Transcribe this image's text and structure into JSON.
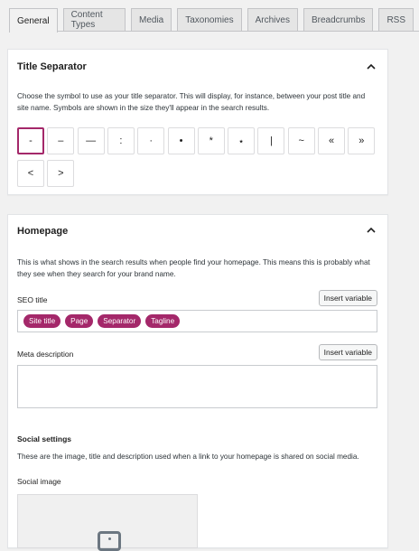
{
  "tabs": [
    "General",
    "Content Types",
    "Media",
    "Taxonomies",
    "Archives",
    "Breadcrumbs",
    "RSS"
  ],
  "active_tab": "General",
  "title_separator": {
    "heading": "Title Separator",
    "description": "Choose the symbol to use as your title separator. This will display, for instance, between your post title and site name. Symbols are shown in the size they'll appear in the search results.",
    "symbols": [
      "-",
      "–",
      "—",
      ":",
      "·",
      "•",
      "*",
      "⋆",
      "|",
      "~",
      "«",
      "»",
      "<",
      ">"
    ],
    "selected": "-"
  },
  "homepage": {
    "heading": "Homepage",
    "description": "This is what shows in the search results when people find your homepage. This means this is probably what they see when they search for your brand name.",
    "seo_title_label": "SEO title",
    "insert_variable_label": "Insert variable",
    "seo_title_chips": [
      "Site title",
      "Page",
      "Separator",
      "Tagline"
    ],
    "meta_description_label": "Meta description",
    "meta_description_value": "",
    "social_settings_heading": "Social settings",
    "social_settings_description": "These are the image, title and description used when a link to your homepage is shared on social media.",
    "social_image_label": "Social image"
  },
  "colors": {
    "accent": "#a4286a"
  }
}
